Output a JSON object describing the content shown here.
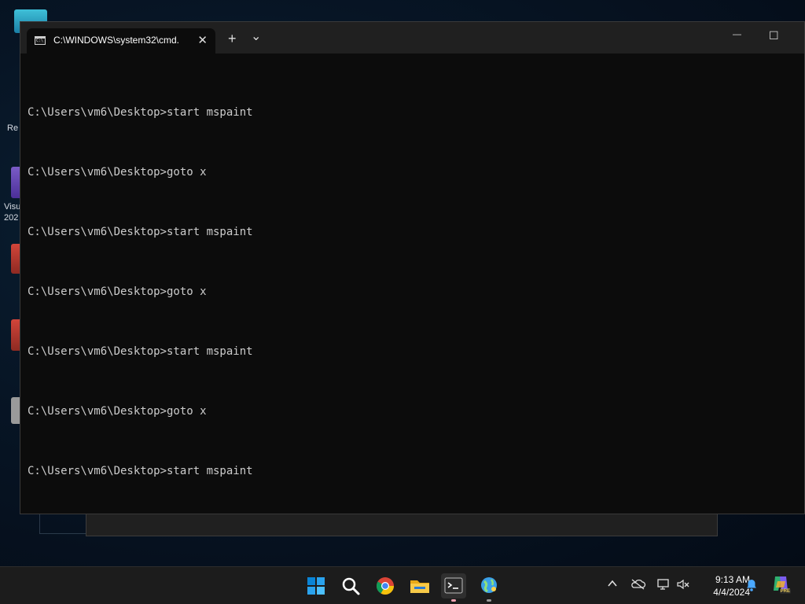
{
  "desktop": {
    "labels": [
      "Re",
      "Visu",
      "202"
    ]
  },
  "window": {
    "tab_title": "C:\\WINDOWS\\system32\\cmd.",
    "tab_icon_text": "C:\\",
    "close_tab_glyph": "✕",
    "new_tab_glyph": "+",
    "dropdown_glyph": "⌄",
    "minimize_glyph": "—",
    "maximize_glyph": "☐"
  },
  "console": {
    "lines": [
      "C:\\Users\\vm6\\Desktop>start mspaint",
      "C:\\Users\\vm6\\Desktop>goto x",
      "C:\\Users\\vm6\\Desktop>start mspaint",
      "C:\\Users\\vm6\\Desktop>goto x",
      "C:\\Users\\vm6\\Desktop>start mspaint",
      "C:\\Users\\vm6\\Desktop>goto x",
      "C:\\Users\\vm6\\Desktop>start mspaint"
    ]
  },
  "taskbar": {
    "apps": [
      "start-icon",
      "search-icon",
      "chrome-icon",
      "file-explorer-icon",
      "terminal-icon",
      "maps-globe-icon"
    ],
    "time": "9:13 AM",
    "date": "4/4/2024",
    "copilot_badge": "PRE"
  },
  "colors": {
    "console_bg": "#0c0c0c",
    "console_text": "#cccccc",
    "titlebar": "#202020",
    "taskbar": "#1c1c1c",
    "accent_indicator": "#f4a3b3",
    "windows_blue": "#0a84d6"
  }
}
